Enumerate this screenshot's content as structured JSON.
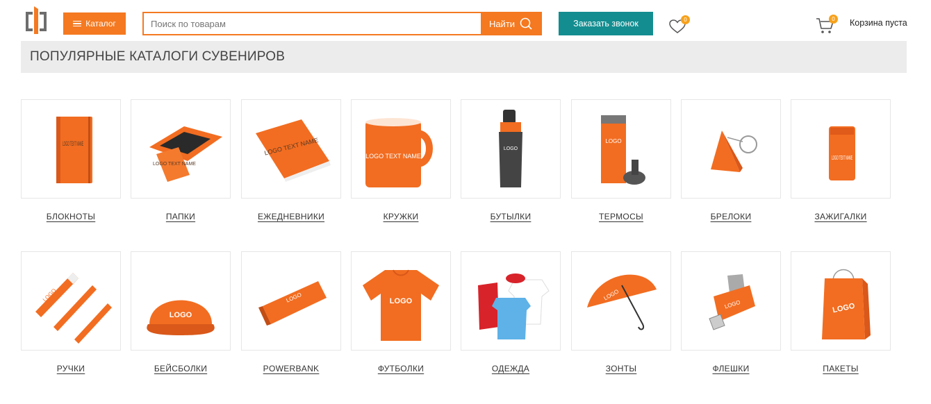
{
  "header": {
    "catalog_label": "Каталог",
    "search_placeholder": "Поиск по товарам",
    "search_button": "Найти",
    "callback_button": "Заказать звонок",
    "wishlist_count": "0",
    "cart_count": "0",
    "cart_text": "Корзина пуста"
  },
  "banner": {
    "title": "ПОПУЛЯРНЫЕ КАТАЛОГИ СУВЕНИРОВ"
  },
  "colors": {
    "accent": "#f47920",
    "teal": "#138d90",
    "badge": "#f7a11a"
  },
  "categories": [
    {
      "label": "БЛОКНОТЫ",
      "icon": "notebook-icon",
      "print": "LOGO TEXT NAME"
    },
    {
      "label": "ПАПКИ",
      "icon": "folder-icon",
      "print": "LOGO TEXT NAME"
    },
    {
      "label": "ЕЖЕДНЕВНИКИ",
      "icon": "planner-icon",
      "print": "LOGO TEXT NAME"
    },
    {
      "label": "КРУЖКИ",
      "icon": "mug-icon",
      "print": "LOGO TEXT NAME"
    },
    {
      "label": "БУТЫЛКИ",
      "icon": "bottle-icon",
      "print": "LOGO"
    },
    {
      "label": "ТЕРМОСЫ",
      "icon": "thermos-icon",
      "print": "LOGO"
    },
    {
      "label": "БРЕЛОКИ",
      "icon": "keychain-icon",
      "print": ""
    },
    {
      "label": "ЗАЖИГАЛКИ",
      "icon": "lighter-icon",
      "print": "LOGO TEXT NAME"
    },
    {
      "label": "РУЧКИ",
      "icon": "pen-icon",
      "print": "LOGO"
    },
    {
      "label": "БЕЙСБОЛКИ",
      "icon": "cap-icon",
      "print": "LOGO"
    },
    {
      "label": "POWERBANK",
      "icon": "powerbank-icon",
      "print": "LOGO"
    },
    {
      "label": "ФУТБОЛКИ",
      "icon": "tshirt-icon",
      "print": "LOGO"
    },
    {
      "label": "ОДЕЖДА",
      "icon": "clothes-icon",
      "print": ""
    },
    {
      "label": "ЗОНТЫ",
      "icon": "umbrella-icon",
      "print": "LOGO"
    },
    {
      "label": "ФЛЕШКИ",
      "icon": "usb-flash-icon",
      "print": "LOGO"
    },
    {
      "label": "ПАКЕТЫ",
      "icon": "bag-icon",
      "print": "LOGO"
    }
  ]
}
